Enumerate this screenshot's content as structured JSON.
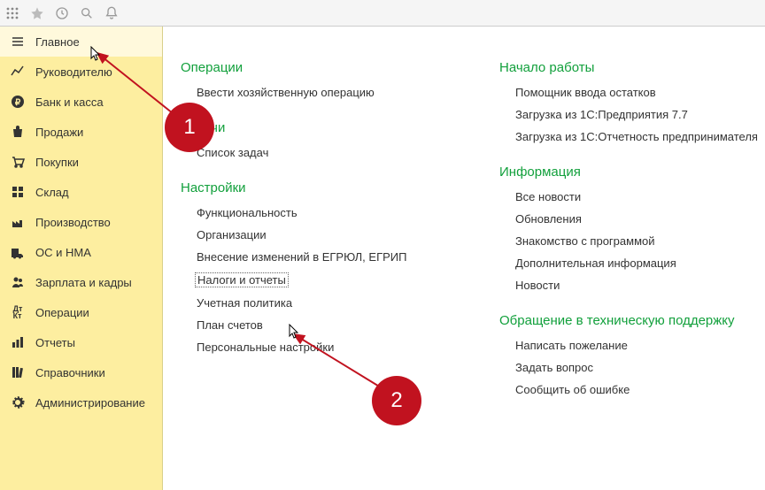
{
  "toolbar": {
    "icons": [
      "apps-icon",
      "star-icon",
      "history-icon",
      "search-icon",
      "bell-icon"
    ]
  },
  "sidebar": {
    "items": [
      {
        "icon": "menu-icon",
        "label": "Главное"
      },
      {
        "icon": "chart-line-icon",
        "label": "Руководителю"
      },
      {
        "icon": "ruble-icon",
        "label": "Банк и касса"
      },
      {
        "icon": "bag-icon",
        "label": "Продажи"
      },
      {
        "icon": "cart-icon",
        "label": "Покупки"
      },
      {
        "icon": "boxes-icon",
        "label": "Склад"
      },
      {
        "icon": "factory-icon",
        "label": "Производство"
      },
      {
        "icon": "truck-icon",
        "label": "ОС и НМА"
      },
      {
        "icon": "people-icon",
        "label": "Зарплата и кадры"
      },
      {
        "icon": "dk-icon",
        "label": "Операции"
      },
      {
        "icon": "bar-chart-icon",
        "label": "Отчеты"
      },
      {
        "icon": "books-icon",
        "label": "Справочники"
      },
      {
        "icon": "gear-icon",
        "label": "Администрирование"
      }
    ]
  },
  "content": {
    "left": [
      {
        "title": "Операции",
        "links": [
          "Ввести хозяйственную операцию"
        ]
      },
      {
        "title": "Задачи",
        "links": [
          "Список задач"
        ]
      },
      {
        "title": "Настройки",
        "links": [
          "Функциональность",
          "Организации",
          "Внесение изменений в ЕГРЮЛ, ЕГРИП",
          "Налоги и отчеты",
          "Учетная политика",
          "План счетов",
          "Персональные настройки"
        ]
      }
    ],
    "right": [
      {
        "title": "Начало работы",
        "links": [
          "Помощник ввода остатков",
          "Загрузка из 1С:Предприятия 7.7",
          "Загрузка из 1С:Отчетность предпринимателя"
        ]
      },
      {
        "title": "Информация",
        "links": [
          "Все новости",
          "Обновления",
          "Знакомство с программой",
          "Дополнительная информация",
          "Новости"
        ]
      },
      {
        "title": "Обращение в техническую поддержку",
        "links": [
          "Написать пожелание",
          "Задать вопрос",
          "Сообщить об ошибке"
        ]
      }
    ]
  },
  "markers": {
    "m1": "1",
    "m2": "2"
  }
}
